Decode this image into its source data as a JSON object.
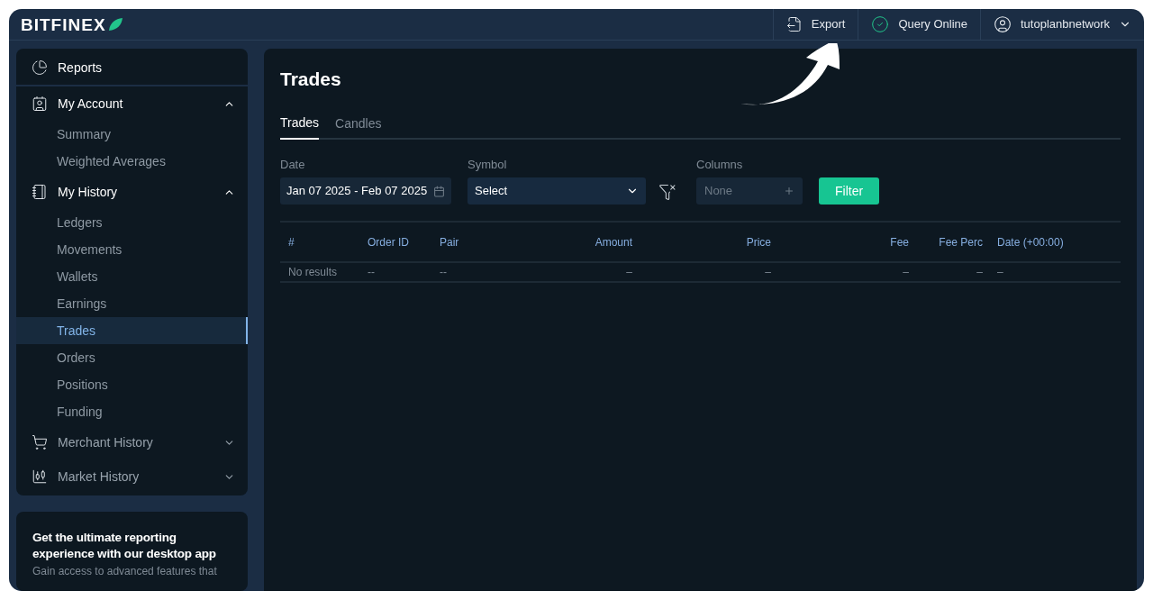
{
  "header": {
    "logo": "BITFINEX",
    "actions": [
      {
        "kind": "export",
        "label": "Export"
      },
      {
        "kind": "status",
        "label": "Query Online"
      },
      {
        "kind": "user",
        "label": "tutoplanbnetwork"
      }
    ]
  },
  "sidebar": {
    "items": [
      {
        "kind": "reports",
        "label": "Reports"
      },
      {
        "kind": "account",
        "label": "My Account",
        "expanded": true,
        "children": [
          {
            "label": "Summary",
            "selected": false
          },
          {
            "label": "Weighted Averages",
            "selected": false
          }
        ]
      },
      {
        "kind": "history",
        "label": "My History",
        "expanded": true,
        "children": [
          {
            "label": "Ledgers",
            "selected": false
          },
          {
            "label": "Movements",
            "selected": false
          },
          {
            "label": "Wallets",
            "selected": false
          },
          {
            "label": "Earnings",
            "selected": false
          },
          {
            "label": "Trades",
            "selected": true
          },
          {
            "label": "Orders",
            "selected": false
          },
          {
            "label": "Positions",
            "selected": false
          },
          {
            "label": "Funding",
            "selected": false
          }
        ]
      },
      {
        "kind": "merchant",
        "label": "Merchant History",
        "expanded": false
      },
      {
        "kind": "market",
        "label": "Market History",
        "expanded": false
      }
    ]
  },
  "promo": {
    "title": "Get the ultimate reporting experience with our desktop app",
    "text": "Gain access to advanced features that"
  },
  "page": {
    "title": "Trades",
    "tabs": [
      {
        "label": "Trades",
        "selected": true
      },
      {
        "label": "Candles",
        "selected": false
      }
    ]
  },
  "filters": {
    "date": {
      "label": "Date",
      "value": "Jan 07 2025 - Feb 07 2025"
    },
    "symbol": {
      "label": "Symbol",
      "value": "Select"
    },
    "columns": {
      "label": "Columns",
      "placeholder": "None"
    },
    "button": "Filter"
  },
  "table": {
    "columns": [
      "#",
      "Order ID",
      "Pair",
      "Amount",
      "Price",
      "Fee",
      "Fee Perc",
      "Date (+00:00)"
    ],
    "rows": [
      [
        "No results",
        "--",
        "--",
        "–",
        "–",
        "–",
        "–",
        "–"
      ]
    ]
  }
}
